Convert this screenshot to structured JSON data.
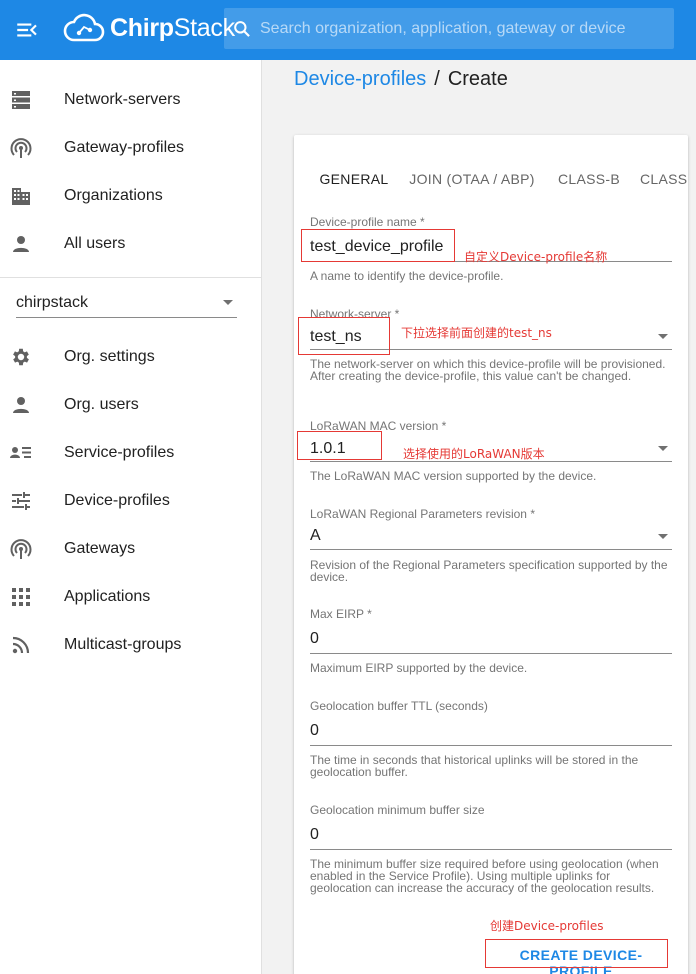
{
  "header": {
    "app_name_bold": "Chirp",
    "app_name_rest": "Stack",
    "search_placeholder": "Search organization, application, gateway or device"
  },
  "sidebar": {
    "global_items": [
      {
        "label": "Network-servers",
        "icon": "server-icon"
      },
      {
        "label": "Gateway-profiles",
        "icon": "antenna-icon"
      },
      {
        "label": "Organizations",
        "icon": "building-icon"
      },
      {
        "label": "All users",
        "icon": "user-icon"
      }
    ],
    "org_selector": "chirpstack",
    "org_items": [
      {
        "label": "Org. settings",
        "icon": "gear-icon"
      },
      {
        "label": "Org. users",
        "icon": "user-icon"
      },
      {
        "label": "Service-profiles",
        "icon": "account-list-icon"
      },
      {
        "label": "Device-profiles",
        "icon": "tune-icon"
      },
      {
        "label": "Gateways",
        "icon": "antenna-icon"
      },
      {
        "label": "Applications",
        "icon": "apps-grid-icon"
      },
      {
        "label": "Multicast-groups",
        "icon": "rss-icon"
      }
    ]
  },
  "breadcrumb": {
    "parent": "Device-profiles",
    "separator": "/",
    "current": "Create"
  },
  "tabs": [
    "GENERAL",
    "JOIN (OTAA / ABP)",
    "CLASS-B",
    "CLASS-C"
  ],
  "form": {
    "name": {
      "label": "Device-profile name *",
      "value": "test_device_profile",
      "help": "A name to identify the device-profile."
    },
    "network_server": {
      "label": "Network-server *",
      "value": "test_ns",
      "help": "The network-server on which this device-profile will be provisioned. After creating the device-profile, this value can't be changed."
    },
    "mac_version": {
      "label": "LoRaWAN MAC version *",
      "value": "1.0.1",
      "help": "The LoRaWAN MAC version supported by the device."
    },
    "regional_revision": {
      "label": "LoRaWAN Regional Parameters revision *",
      "value": "A",
      "help": "Revision of the Regional Parameters specification supported by the device."
    },
    "max_eirp": {
      "label": "Max EIRP *",
      "value": "0",
      "help": "Maximum EIRP supported by the device."
    },
    "geo_ttl": {
      "label": "Geolocation buffer TTL (seconds)",
      "value": "0",
      "help": "The time in seconds that historical uplinks will be stored in the geolocation buffer."
    },
    "geo_min": {
      "label": "Geolocation minimum buffer size",
      "value": "0",
      "help": "The minimum buffer size required before using geolocation (when enabled in the Service Profile). Using multiple uplinks for geolocation can increase the accuracy of the geolocation results."
    },
    "submit_label": "CREATE DEVICE-PROFILE"
  },
  "annotations": {
    "name_note": "自定义Device-profile名称",
    "ns_note": "下拉选择前面创建的test_ns",
    "mac_note": "选择使用的LoRaWAN版本",
    "create_note": "创建Device-profiles"
  },
  "colors": {
    "primary": "#1e88e5",
    "annotation_red": "#e53935"
  }
}
